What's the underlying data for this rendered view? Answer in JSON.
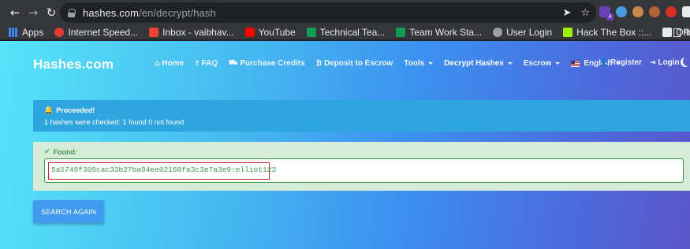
{
  "browser": {
    "url_host": "hashes.com",
    "url_path": "/en/decrypt/hash",
    "extension_badge": "4"
  },
  "bookmarks": [
    {
      "label": "Apps",
      "color": "#4285f4"
    },
    {
      "label": "Internet Speed...",
      "color": "#e53935"
    },
    {
      "label": "Inbox - vaibhav...",
      "color": "#ea4335"
    },
    {
      "label": "YouTube",
      "color": "#ff0000"
    },
    {
      "label": "Technical Tea...",
      "color": "#0f9d58"
    },
    {
      "label": "Team Work Sta...",
      "color": "#0f9d58"
    },
    {
      "label": "User Login",
      "color": "#9aa0a6"
    },
    {
      "label": "Hack The Box ::...",
      "color": "#9fef00"
    },
    {
      "label": "OffensiveSecur...",
      "color": "#e8eaed"
    }
  ],
  "bookmarks_more": "»",
  "bookmarks_reading": "R",
  "site": {
    "brand": "Hashes.com",
    "menu": {
      "home": "Home",
      "faq": "FAQ",
      "purchase": "Purchase Credits",
      "deposit": "Deposit to Escrow",
      "tools": "Tools",
      "decrypt": "Decrypt Hashes",
      "escrow": "Escrow",
      "language": "English"
    },
    "register": "Register",
    "login": "Login"
  },
  "alert": {
    "title": "Proceeded!",
    "message": "1 hashes were checked: 1 found 0 not found"
  },
  "found": {
    "label": "Found:",
    "result": "5a5749f309cac33b27ba94ee02168fa3c3e7a3e9:elliot123"
  },
  "actions": {
    "search_again": "SEARCH AGAIN"
  },
  "colors": {
    "accent": "#3f9af0",
    "success": "#3d9a4a",
    "highlight": "#c0282e",
    "info": "#2fa5e0"
  }
}
